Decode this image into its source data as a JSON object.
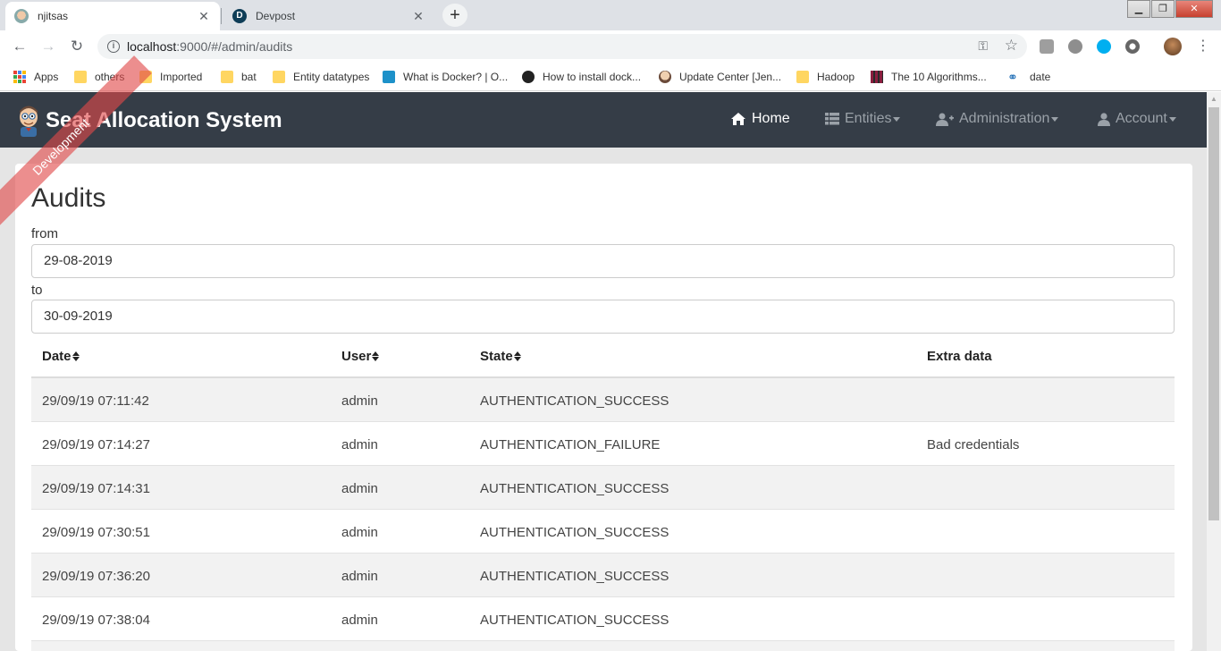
{
  "browser": {
    "tabs": [
      {
        "title": "njitsas",
        "active": true
      },
      {
        "title": "Devpost",
        "active": false
      }
    ],
    "url_host": "localhost",
    "url_path": ":9000/#/admin/audits",
    "window_controls": {
      "minimize": "▁",
      "maximize": "❐",
      "close": "✕"
    },
    "bookmarks": [
      {
        "label": "Apps",
        "icon": "apps-grid-icon"
      },
      {
        "label": "others",
        "icon": "folder-icon"
      },
      {
        "label": "Imported",
        "icon": "folder-icon"
      },
      {
        "label": "bat",
        "icon": "folder-icon"
      },
      {
        "label": "Entity datatypes",
        "icon": "folder-icon"
      },
      {
        "label": "What is Docker? | O...",
        "icon": "docker-icon"
      },
      {
        "label": "How to install dock...",
        "icon": "site-icon"
      },
      {
        "label": "Update Center [Jen...",
        "icon": "jenkins-icon"
      },
      {
        "label": "Hadoop",
        "icon": "folder-icon"
      },
      {
        "label": "The 10 Algorithms...",
        "icon": "site-icon"
      },
      {
        "label": "date",
        "icon": "link-icon"
      }
    ]
  },
  "app": {
    "title": "Seat Allocation System",
    "ribbon": "Development",
    "nav": [
      {
        "label": "Home",
        "icon": "home-icon",
        "active": true,
        "dropdown": false
      },
      {
        "label": "Entities",
        "icon": "list-icon",
        "active": false,
        "dropdown": true
      },
      {
        "label": "Administration",
        "icon": "user-plus-icon",
        "active": false,
        "dropdown": true
      },
      {
        "label": "Account",
        "icon": "user-icon",
        "active": false,
        "dropdown": true
      }
    ]
  },
  "page": {
    "heading": "Audits",
    "from_label": "from",
    "from_value": "29-08-2019",
    "to_label": "to",
    "to_value": "30-09-2019",
    "columns": [
      "Date",
      "User",
      "State",
      "Extra data"
    ],
    "rows": [
      {
        "date": "29/09/19 07:11:42",
        "user": "admin",
        "state": "AUTHENTICATION_SUCCESS",
        "extra": ""
      },
      {
        "date": "29/09/19 07:14:27",
        "user": "admin",
        "state": "AUTHENTICATION_FAILURE",
        "extra": "Bad credentials"
      },
      {
        "date": "29/09/19 07:14:31",
        "user": "admin",
        "state": "AUTHENTICATION_SUCCESS",
        "extra": ""
      },
      {
        "date": "29/09/19 07:30:51",
        "user": "admin",
        "state": "AUTHENTICATION_SUCCESS",
        "extra": ""
      },
      {
        "date": "29/09/19 07:36:20",
        "user": "admin",
        "state": "AUTHENTICATION_SUCCESS",
        "extra": ""
      },
      {
        "date": "29/09/19 07:38:04",
        "user": "admin",
        "state": "AUTHENTICATION_SUCCESS",
        "extra": ""
      }
    ]
  },
  "colors": {
    "navbar": "#353d47",
    "ribbon": "#e04848",
    "stripe": "#f2f2f2",
    "page_bg": "#e5e5e5"
  }
}
